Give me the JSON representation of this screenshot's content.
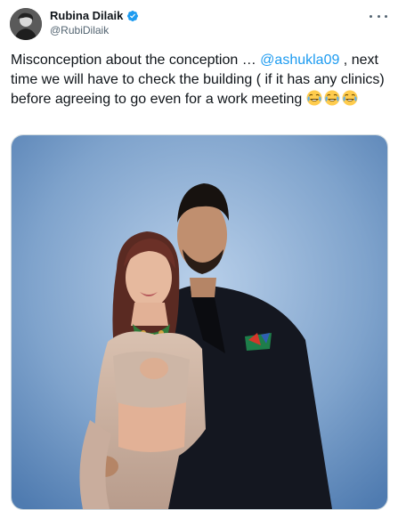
{
  "tweet": {
    "display_name": "Rubina Dilaik",
    "handle": "@RubiDilaik",
    "text_before": "Misconception about the conception … ",
    "mention": "@ashukla09",
    "text_after": " , next time we will have to check the building ( if it has any clinics) before agreeing to go even for a work meeting ",
    "emoji": [
      "😂",
      "😂",
      "😂"
    ],
    "verified": true
  },
  "colors": {
    "link": "#1d9bf0",
    "verified_badge": "#1d9bf0",
    "text": "#0f1419",
    "secondary": "#536471",
    "photo_background": "#7fa3cc"
  },
  "icons": [
    "profile-avatar",
    "verified-badge-icon",
    "more-options-icon",
    "face-with-tears-of-joy-emoji"
  ]
}
